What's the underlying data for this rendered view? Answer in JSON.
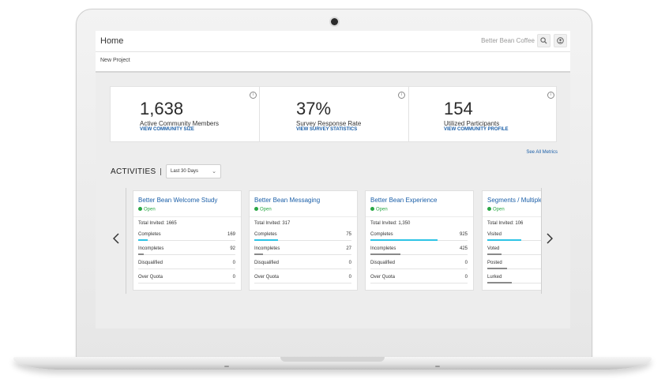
{
  "app": {
    "title": "Home",
    "brand": "Better Bean Coffee",
    "breadcrumb": "New Project"
  },
  "icons": {
    "search": "search-icon",
    "account": "account-icon",
    "info": "info-icon",
    "prev": "chevron-left-icon",
    "next": "chevron-right-icon",
    "dropdown": "chevron-down-icon"
  },
  "metrics": [
    {
      "value": "1,638",
      "label": "Active Community Members",
      "link": "VIEW COMMUNITY SIZE"
    },
    {
      "value": "37%",
      "label": "Survey Response Rate",
      "link": "VIEW SURVEY STATISTICS"
    },
    {
      "value": "154",
      "label": "Utilized Participants",
      "link": "VIEW COMMUNITY PROFILE"
    }
  ],
  "see_all": "See All Metrics",
  "activities": {
    "title": "ACTIVITIES",
    "range": "Last 30 Days",
    "cards": [
      {
        "title": "Better Bean Welcome Study",
        "status": "Open",
        "invited": "Total Invited: 1665",
        "rows": [
          {
            "label": "Completes",
            "value": "169",
            "level": 0.1,
            "color": "#2ec4e6"
          },
          {
            "label": "Incompletes",
            "value": "92",
            "level": 0.06,
            "color": "#8a8a8a"
          },
          {
            "label": "Disqualified",
            "value": "0",
            "level": 0,
            "color": "#8a8a8a"
          },
          {
            "label": "Over Quota",
            "value": "0",
            "level": 0,
            "color": "#8a8a8a"
          }
        ]
      },
      {
        "title": "Better Bean Messaging",
        "status": "Open",
        "invited": "Total Invited: 317",
        "rows": [
          {
            "label": "Completes",
            "value": "75",
            "level": 0.24,
            "color": "#2ec4e6"
          },
          {
            "label": "Incompletes",
            "value": "27",
            "level": 0.09,
            "color": "#8a8a8a"
          },
          {
            "label": "Disqualified",
            "value": "0",
            "level": 0,
            "color": "#8a8a8a"
          },
          {
            "label": "Over Quota",
            "value": "0",
            "level": 0,
            "color": "#8a8a8a"
          }
        ]
      },
      {
        "title": "Better Bean Experience",
        "status": "Open",
        "invited": "Total Invited: 1,350",
        "rows": [
          {
            "label": "Completes",
            "value": "925",
            "level": 0.69,
            "color": "#2ec4e6"
          },
          {
            "label": "Incompletes",
            "value": "425",
            "level": 0.31,
            "color": "#8a8a8a"
          },
          {
            "label": "Disqualified",
            "value": "0",
            "level": 0,
            "color": "#8a8a8a"
          },
          {
            "label": "Over Quota",
            "value": "0",
            "level": 0,
            "color": "#8a8a8a"
          }
        ]
      },
      {
        "title": "Segments / Multiple",
        "status": "Open",
        "invited": "Total Invited: 106",
        "rows": [
          {
            "label": "Visited",
            "value": "",
            "level": 0.35,
            "color": "#2ec4e6"
          },
          {
            "label": "Voted",
            "value": "",
            "level": 0.15,
            "color": "#8a8a8a"
          },
          {
            "label": "Posted",
            "value": "",
            "level": 0.2,
            "color": "#8a8a8a"
          },
          {
            "label": "Lurked",
            "value": "",
            "level": 0.25,
            "color": "#8a8a8a"
          }
        ]
      }
    ]
  }
}
